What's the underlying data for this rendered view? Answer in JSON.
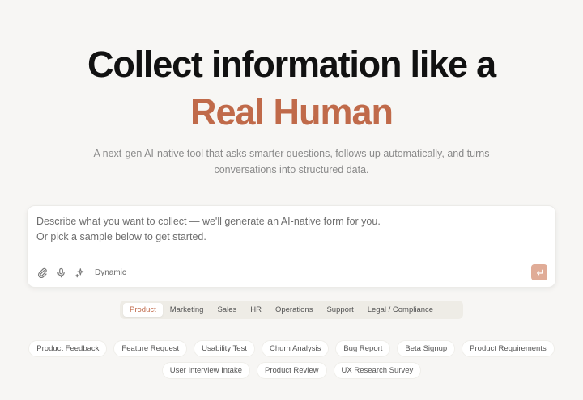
{
  "hero": {
    "headline": "Collect information like a",
    "headline_accent": "Real Human",
    "subtitle_line1": "A next-gen AI-native tool that asks smarter questions, follows up automatically, and turns",
    "subtitle_line2": "conversations into structured data."
  },
  "prompt": {
    "placeholder_line1": "Describe what you want to collect — we'll generate an AI-native form for you.",
    "placeholder_line2": "Or pick a sample below to get started.",
    "tools": [
      "paperclip-icon",
      "microphone-icon",
      "sparkle-icon"
    ],
    "mode_label": "Dynamic",
    "submit_icon": "enter-icon"
  },
  "categories": {
    "active": "Product",
    "items": [
      "Product",
      "Marketing",
      "Sales",
      "HR",
      "Operations",
      "Support",
      "Legal / Compliance"
    ]
  },
  "samples": {
    "row1": [
      "Product Feedback",
      "Feature Request",
      "Usability Test",
      "Churn Analysis",
      "Bug Report",
      "Beta Signup",
      "Product Requirements"
    ],
    "row2": [
      "User Interview Intake",
      "Product Review",
      "UX Research Survey"
    ]
  },
  "colors": {
    "accent": "#c06a4a",
    "submit_bg": "#e0ac97",
    "page_bg": "#f7f6f4"
  }
}
